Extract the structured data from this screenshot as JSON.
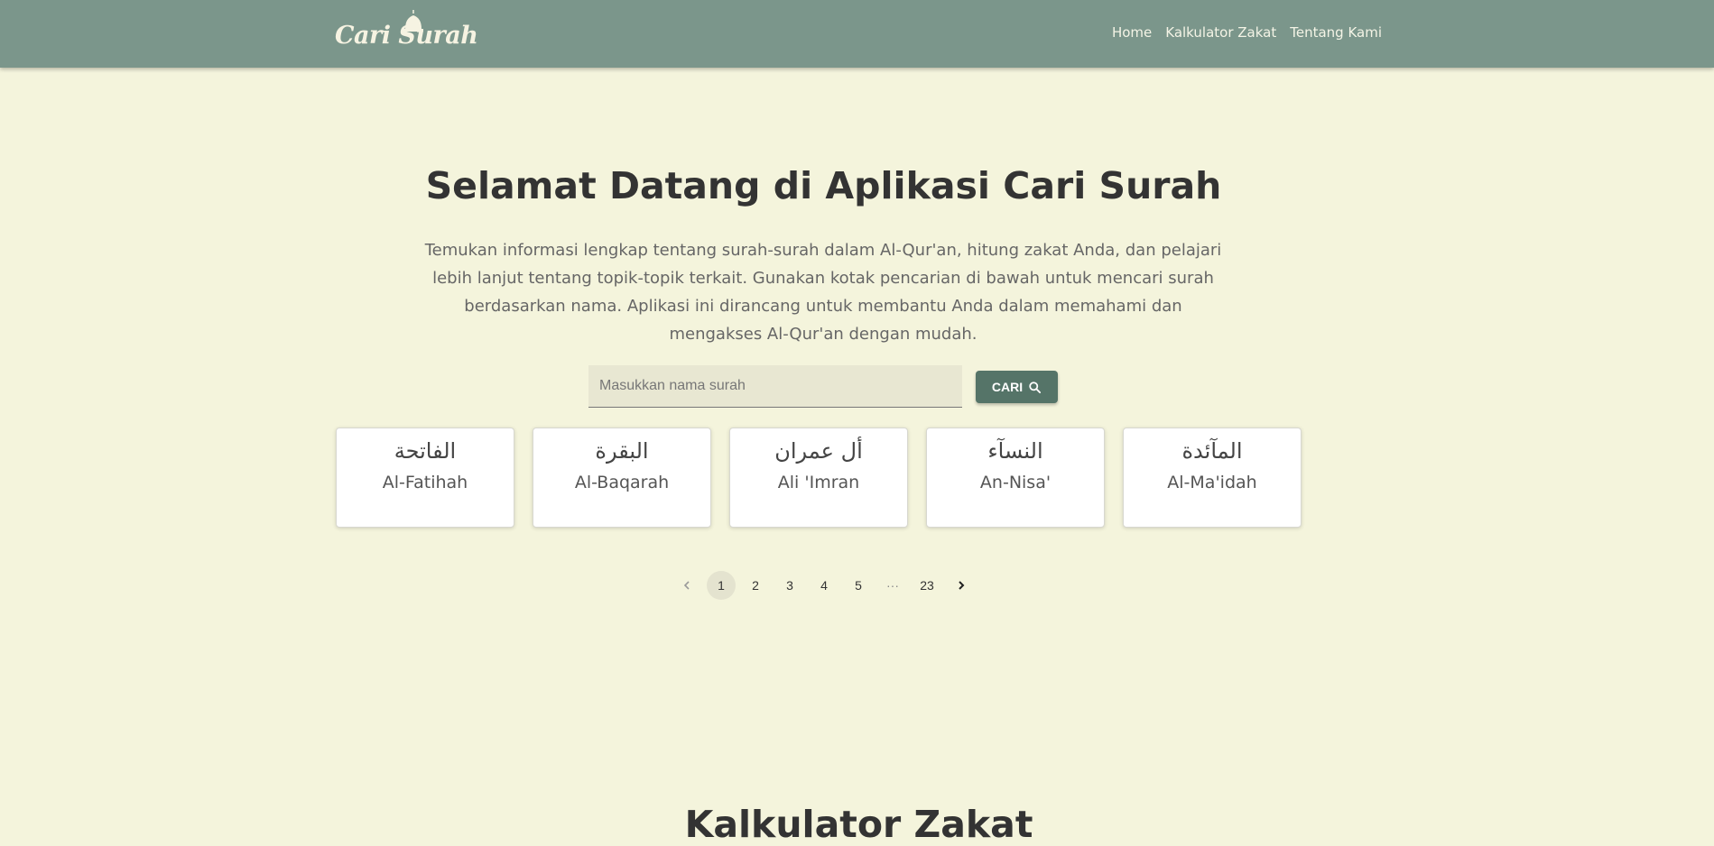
{
  "nav": {
    "logo_text": "Cari Surah",
    "links": [
      "Home",
      "Kalkulator Zakat",
      "Tentang Kami"
    ]
  },
  "hero": {
    "title": "Selamat Datang di Aplikasi Cari Surah",
    "description": "Temukan informasi lengkap tentang surah-surah dalam Al-Qur'an, hitung zakat Anda, dan pelajari lebih lanjut tentang topik-topik terkait. Gunakan kotak pencarian di bawah untuk mencari surah berdasarkan nama. Aplikasi ini dirancang untuk membantu Anda dalam memahami dan mengakses Al-Qur'an dengan mudah."
  },
  "search": {
    "placeholder": "Masukkan nama surah",
    "value": "",
    "button_label": "CARI",
    "button_icon": "search-icon"
  },
  "surahs": [
    {
      "arabic": "الفاتحة",
      "latin": "Al-Fatihah"
    },
    {
      "arabic": "البقرة",
      "latin": "Al-Baqarah"
    },
    {
      "arabic": "أل عمران",
      "latin": "Ali 'Imran"
    },
    {
      "arabic": "النسآء",
      "latin": "An-Nisa'"
    },
    {
      "arabic": "المآئدة",
      "latin": "Al-Ma'idah"
    }
  ],
  "pagination": {
    "prev_icon": "chevron-left-icon",
    "pages": [
      "1",
      "2",
      "3",
      "4",
      "5"
    ],
    "ellipsis": "···",
    "last": "23",
    "current": "1",
    "next_icon": "chevron-right-icon"
  },
  "zakat_section": {
    "title": "Kalkulator Zakat"
  },
  "colors": {
    "navbar": "#7b968b",
    "background": "#f4f4dc",
    "button": "#557468",
    "input_bg": "#e8e7d2"
  }
}
